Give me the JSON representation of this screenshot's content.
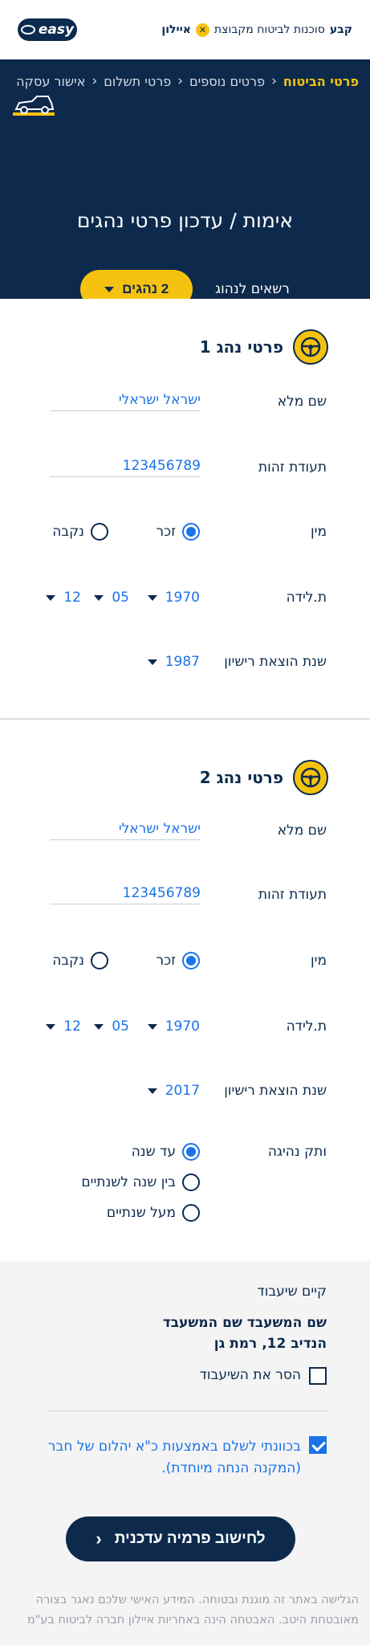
{
  "header": {
    "company_prefix": "קבע",
    "company_text": "סוכנות לביטוח מקבוצת",
    "parent_brand": "איילון",
    "app_logo": "easy"
  },
  "breadcrumbs": [
    "פרטי הביטוח",
    "פרטים נוספים",
    "פרטי תשלום",
    "אישור עסקה"
  ],
  "hero": {
    "title": "אימות / עדכון פרטי נהגים",
    "drivers_label": "רשאים לנהוג",
    "drivers_value": "2 נהגים"
  },
  "labels": {
    "full_name": "שם מלא",
    "id_number": "תעודת זהות",
    "gender": "מין",
    "male": "זכר",
    "female": "נקבה",
    "birth": "ת.לידה",
    "license_year": "שנת הוצאת רישיון",
    "seniority": "ותק נהיגה"
  },
  "drivers": [
    {
      "title": "פרטי נהג 1",
      "full_name": "ישראל ישראלי",
      "id_number": "123456789",
      "gender": "זכר",
      "birth_year": "1970",
      "birth_month": "05",
      "birth_day": "12",
      "license_year": "1987"
    },
    {
      "title": "פרטי נהג 2",
      "full_name": "ישראל ישראלי",
      "id_number": "123456789",
      "gender": "זכר",
      "birth_year": "1970",
      "birth_month": "05",
      "birth_day": "12",
      "license_year": "2017",
      "seniority_options": [
        "עד שנה",
        "בין שנה לשנתיים",
        "מעל  שנתיים"
      ],
      "seniority_selected": "עד שנה"
    }
  ],
  "lien": {
    "label": "קיים שיעבוד",
    "lender_name": "שם המשעבד שם המשעבד",
    "lender_address": "הנדיב 12, רמת גן",
    "remove_label": "הסר את השיעבוד",
    "remove_checked": false
  },
  "payment_consent": {
    "line1": "בכוונתי לשלם באמצעות כ\"א יהלום של חבר",
    "line2": "(המקנה הנחה מיוחדת).",
    "checked": true
  },
  "cta": {
    "label": "לחישוב פרמיה עדכנית"
  },
  "disclaimer": {
    "line1": "הגלישה באתר זה מוגנת ובטוחה. המידע האישי שלכם נאגר בצורה",
    "line2": "מאובטחת היטב. האבטחה הינה באחריות איילון חברה לביטוח בע\"מ"
  },
  "colors": {
    "navy": "#0d2a4d",
    "accent_yellow": "#f5c30f",
    "link_blue": "#1a73e8",
    "panel_bg": "#f4f4f5"
  }
}
